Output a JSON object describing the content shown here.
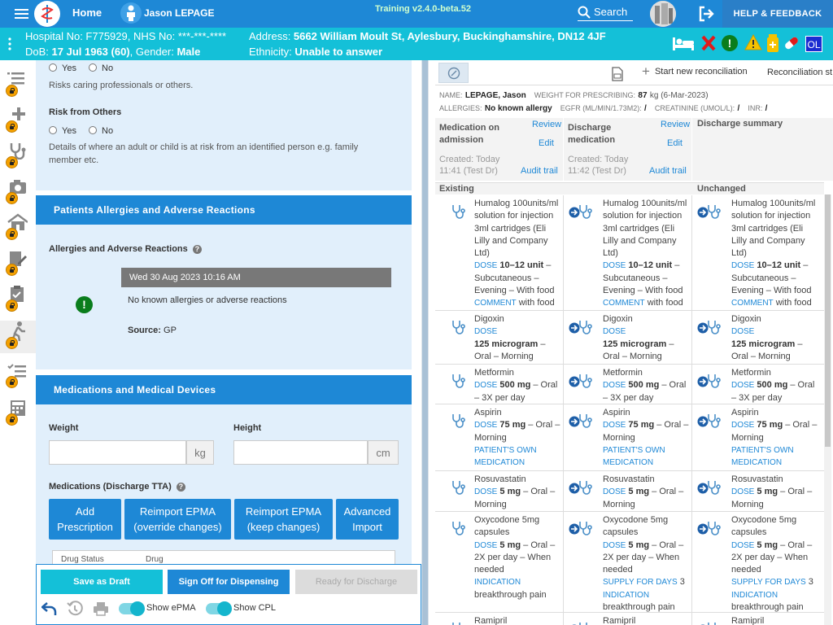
{
  "header": {
    "home_label": "Home",
    "user_name": "Jason LEPAGE",
    "version": "Training v2.4.0-beta.52",
    "search_label": "Search",
    "help_label": "HELP & FEEDBACK"
  },
  "patient": {
    "hospital_line": "Hospital No: F775929, NHS No: ***-***-****",
    "dob_prefix": "DoB: ",
    "dob_value": "17 Jul 1963 (60)",
    "gender_prefix": ", Gender: ",
    "gender_value": "Male",
    "address_prefix": "Address: ",
    "address_value": "5662 William Moult St, Aylesbury, Buckinghamshire, DN12 4JF",
    "ethnicity_prefix": "Ethnicity: ",
    "ethnicity_value": "Unable to answer",
    "badge_initials": "OL"
  },
  "left": {
    "yes": "Yes",
    "no": "No",
    "risk_caring_text": "Risks caring professionals or others.",
    "risk_others_title": "Risk from Others",
    "risk_others_desc_1": "Details of where an adult or child is at risk from an identified person e.g. family",
    "risk_others_desc_2": "member etc.",
    "allergies_header": "Patients Allergies and Adverse Reactions",
    "allergies_label": "Allergies and Adverse Reactions",
    "allergy_timestamp": "Wed 30 Aug 2023 10:16 AM",
    "allergy_text": "No known allergies or adverse reactions",
    "source_label": "Source:",
    "source_value": "GP",
    "meds_header": "Medications and Medical Devices",
    "weight_label": "Weight",
    "weight_unit": "kg",
    "height_label": "Height",
    "height_unit": "cm",
    "meds_tta_label": "Medications (Discharge TTA)",
    "btn_add_1": "Add",
    "btn_add_2": "Prescription",
    "btn_reimport_override_1": "Reimport EPMA",
    "btn_reimport_override_2": "(override changes)",
    "btn_reimport_keep_1": "Reimport EPMA",
    "btn_reimport_keep_2": "(keep changes)",
    "btn_advanced_1": "Advanced",
    "btn_advanced_2": "Import",
    "table_col_status": "Drug Status",
    "table_col_drug": "Drug"
  },
  "footer": {
    "save_draft": "Save as Draft",
    "sign_off": "Sign Off for Dispensing",
    "ready": "Ready for Discharge",
    "show_epma": "Show ePMA",
    "show_cpl": "Show CPL"
  },
  "right": {
    "start_reconciliation": "Start new reconciliation",
    "reconciliation_status": "Reconciliation st",
    "name_label": "NAME:",
    "name_value": "LEPAGE, Jason",
    "weight_label": "WEIGHT FOR PRESCRIBING:",
    "weight_value": "87",
    "weight_rest": "kg (6-Mar-2023)",
    "allergies_label": "ALLERGIES:",
    "allergies_value": "No known allergy",
    "egfr_label": "EGFR (ML/MIN/1.73M2):",
    "egfr_value": "/",
    "creat_label": "CREATININE (UMOL/L):",
    "creat_value": "/",
    "inr_label": "INR:",
    "inr_value": "/",
    "col1_title_1": "Medication on",
    "col1_title_2": "admission",
    "col1_created_1": "Created: Today",
    "col1_created_2": "11:41 (Test Dr)",
    "col2_title_1": "Discharge",
    "col2_title_2": "medication",
    "col2_created_1": "Created: Today",
    "col2_created_2": "11:42 (Test Dr)",
    "col3_title": "Discharge summary",
    "review": "Review",
    "edit": "Edit",
    "audit_trail": "Audit trail",
    "group_existing": "Existing",
    "group_unchanged": "Unchanged",
    "meds": [
      {
        "lines": [
          "Humalog 100units/ml",
          "solution for injection",
          "3ml cartridges (Eli",
          "Lilly and Company",
          "Ltd)",
          "[DOSE] *10–12 unit* –",
          "Subcutaneous –",
          "Evening – With food",
          "[COMMENT] with food"
        ]
      },
      {
        "lines": [
          "Digoxin",
          "[DOSE]",
          "*125 microgram* –",
          "Oral – Morning"
        ]
      },
      {
        "lines": [
          "Metformin",
          "[DOSE] *500 mg* – Oral",
          "– 3X per day"
        ]
      },
      {
        "lines": [
          "Aspirin",
          "[DOSE] *75 mg* – Oral –",
          "Morning",
          "[PATIENT'S OWN]",
          "[MEDICATION]"
        ]
      },
      {
        "lines": [
          "Rosuvastatin",
          "[DOSE] *5 mg* – Oral –",
          "Morning"
        ]
      },
      {
        "lines": [
          "Oxycodone 5mg",
          "capsules",
          "[DOSE] *5 mg* – Oral –",
          "2X per day – When",
          "needed",
          "[INDICATION]",
          "breakthrough pain"
        ],
        "lines_col2": [
          "Oxycodone 5mg",
          "capsules",
          "[DOSE] *5 mg* – Oral –",
          "2X per day – When",
          "needed",
          "[SUPPLY FOR DAYS] 3",
          "[INDICATION]",
          "breakthrough pain"
        ]
      },
      {
        "lines": [
          "Ramipril"
        ]
      }
    ]
  }
}
